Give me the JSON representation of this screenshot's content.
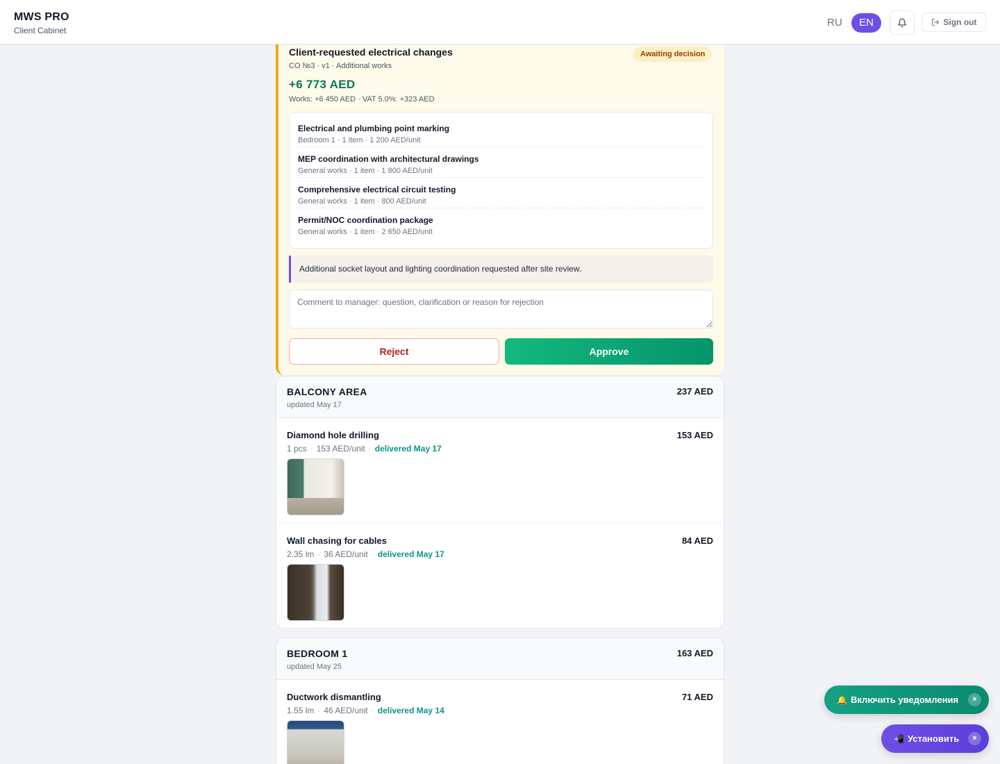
{
  "header": {
    "brand_title": "MWS PRO",
    "brand_subtitle": "Client Cabinet",
    "lang_ru": "RU",
    "lang_en": "EN",
    "signout_label": "Sign out"
  },
  "change_order": {
    "title": "Client-requested electrical changes",
    "meta": "CO №3 · v1 · Additional works",
    "status": "Awaiting decision",
    "amount": "+6 773 AED",
    "breakdown": "Works: +6 450 AED · VAT 5.0%: +323 AED",
    "items": [
      {
        "name": "Electrical and plumbing point marking",
        "meta": "Bedroom 1 · 1 item · 1 200 AED/unit"
      },
      {
        "name": "MEP coordination with architectural drawings",
        "meta": "General works · 1 item · 1 800 AED/unit"
      },
      {
        "name": "Comprehensive electrical circuit testing",
        "meta": "General works · 1 item · 800 AED/unit"
      },
      {
        "name": "Permit/NOC coordination package",
        "meta": "General works · 1 item · 2 650 AED/unit"
      }
    ],
    "note": "Additional socket layout and lighting coordination requested after site review.",
    "comment_placeholder": "Comment to manager: question, clarification or reason for rejection",
    "reject_label": "Reject",
    "approve_label": "Approve",
    "accent_color": "#f2a516"
  },
  "rooms": [
    {
      "name": "BALCONY AREA",
      "updated": "updated May 17",
      "total": "237 AED",
      "works": [
        {
          "name": "Diamond hole drilling",
          "qty": "1 pcs",
          "unit_price": "153 AED/unit",
          "delivered": "delivered May 17",
          "price": "153 AED"
        },
        {
          "name": "Wall chasing for cables",
          "qty": "2.35 lm",
          "unit_price": "36 AED/unit",
          "delivered": "delivered May 17",
          "price": "84 AED"
        }
      ]
    },
    {
      "name": "BEDROOM 1",
      "updated": "updated May 25",
      "total": "163 AED",
      "works": [
        {
          "name": "Ductwork dismantling",
          "qty": "1.55 lm",
          "unit_price": "46 AED/unit",
          "delivered": "delivered May 14",
          "price": "71 AED"
        }
      ]
    }
  ],
  "floating": {
    "notify_label": "Включить уведомления",
    "notify_emoji": "🔔",
    "install_label": "Установить",
    "install_emoji": "📲",
    "close_glyph": "×"
  }
}
